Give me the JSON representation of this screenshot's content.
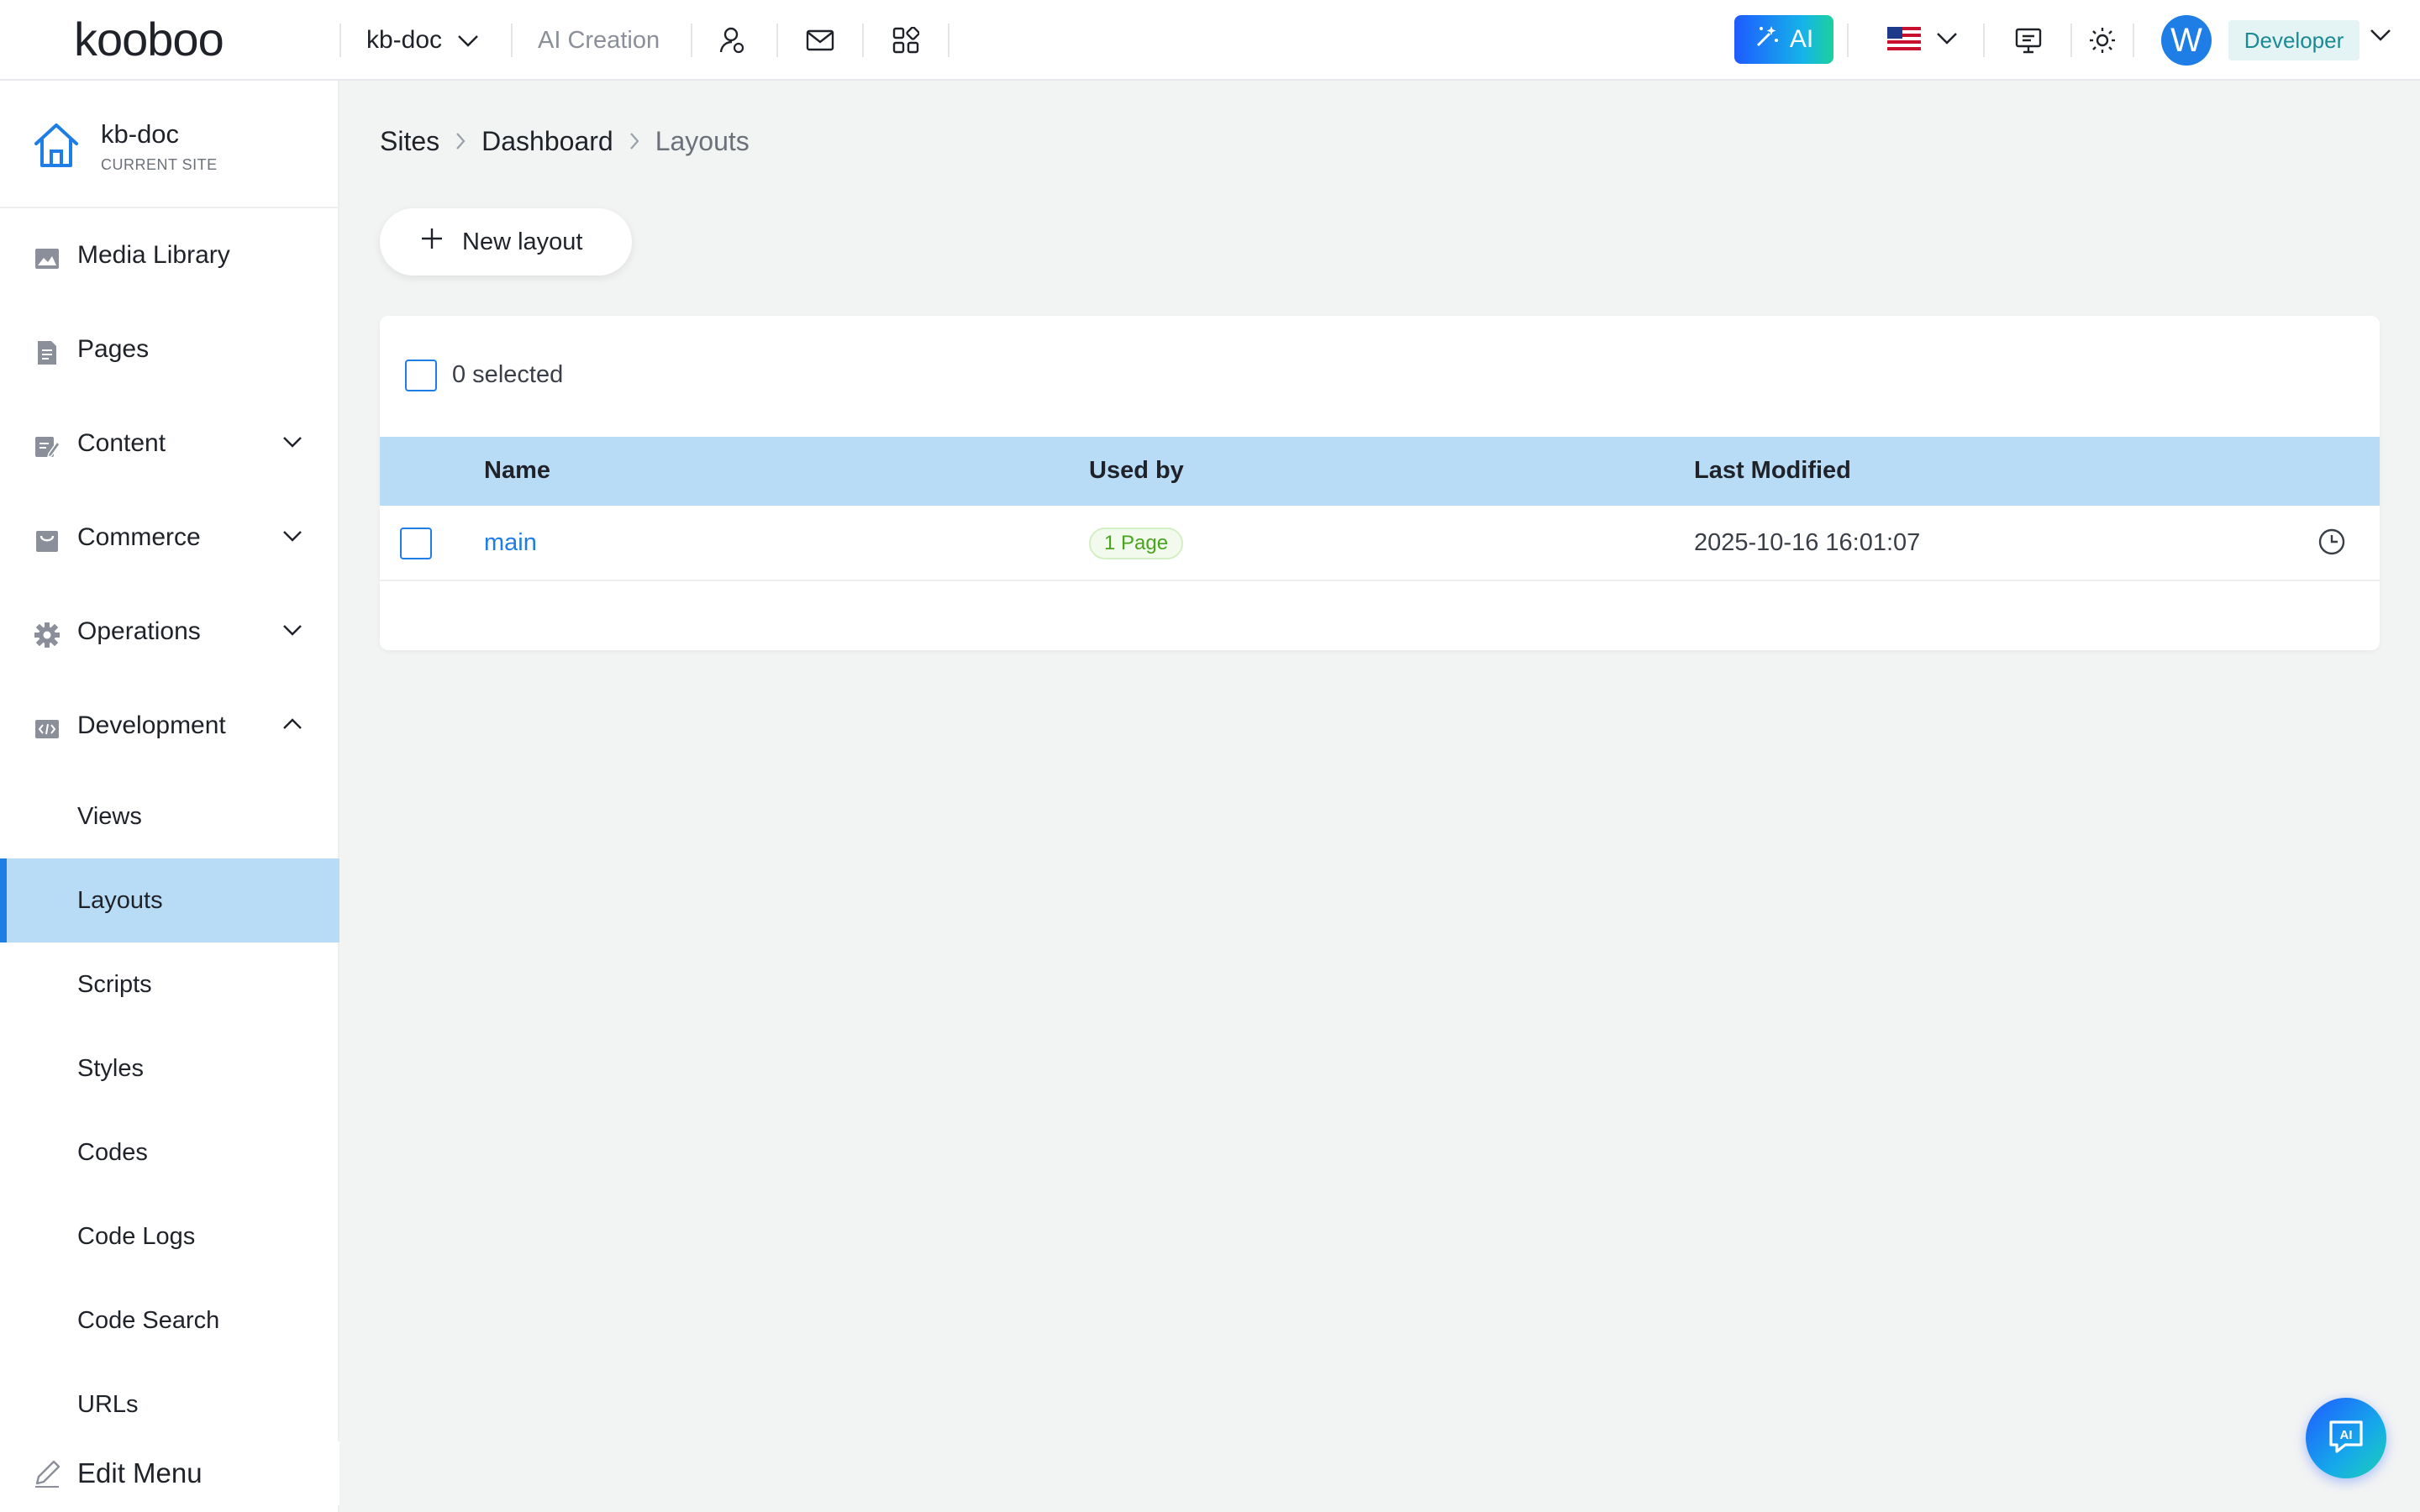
{
  "brand": {
    "logo_text": "kooboo"
  },
  "topbar": {
    "site_name": "kb-doc",
    "ai_creation_label": "AI Creation",
    "ai_button_label": "AI",
    "user_initial": "W",
    "role_label": "Developer"
  },
  "sidebar": {
    "current_site_name": "kb-doc",
    "current_site_caption": "CURRENT SITE",
    "items": [
      {
        "label": "Media Library",
        "icon": "image-icon"
      },
      {
        "label": "Pages",
        "icon": "document-icon"
      },
      {
        "label": "Content",
        "icon": "edit-icon"
      },
      {
        "label": "Commerce",
        "icon": "store-icon"
      },
      {
        "label": "Operations",
        "icon": "gear-icon"
      },
      {
        "label": "Development",
        "icon": "code-icon"
      }
    ],
    "development_children": [
      {
        "label": "Views"
      },
      {
        "label": "Layouts"
      },
      {
        "label": "Scripts"
      },
      {
        "label": "Styles"
      },
      {
        "label": "Codes"
      },
      {
        "label": "Code Logs"
      },
      {
        "label": "Code Search"
      },
      {
        "label": "URLs"
      }
    ],
    "active_child": "Layouts",
    "edit_menu_label": "Edit Menu"
  },
  "breadcrumb": {
    "items": [
      "Sites",
      "Dashboard",
      "Layouts"
    ]
  },
  "toolbar": {
    "new_layout_label": "New layout"
  },
  "table": {
    "selected_text": "0 selected",
    "columns": [
      "Name",
      "Used by",
      "Last Modified"
    ],
    "rows": [
      {
        "name": "main",
        "used_by": "1 Page",
        "last_modified": "2025-10-16 16:01:07"
      }
    ]
  },
  "colors": {
    "accent": "#1f7de6",
    "selected_bg": "#b9dcf6",
    "tag_green": "#4aa31f",
    "role_teal": "#1a8a95"
  }
}
